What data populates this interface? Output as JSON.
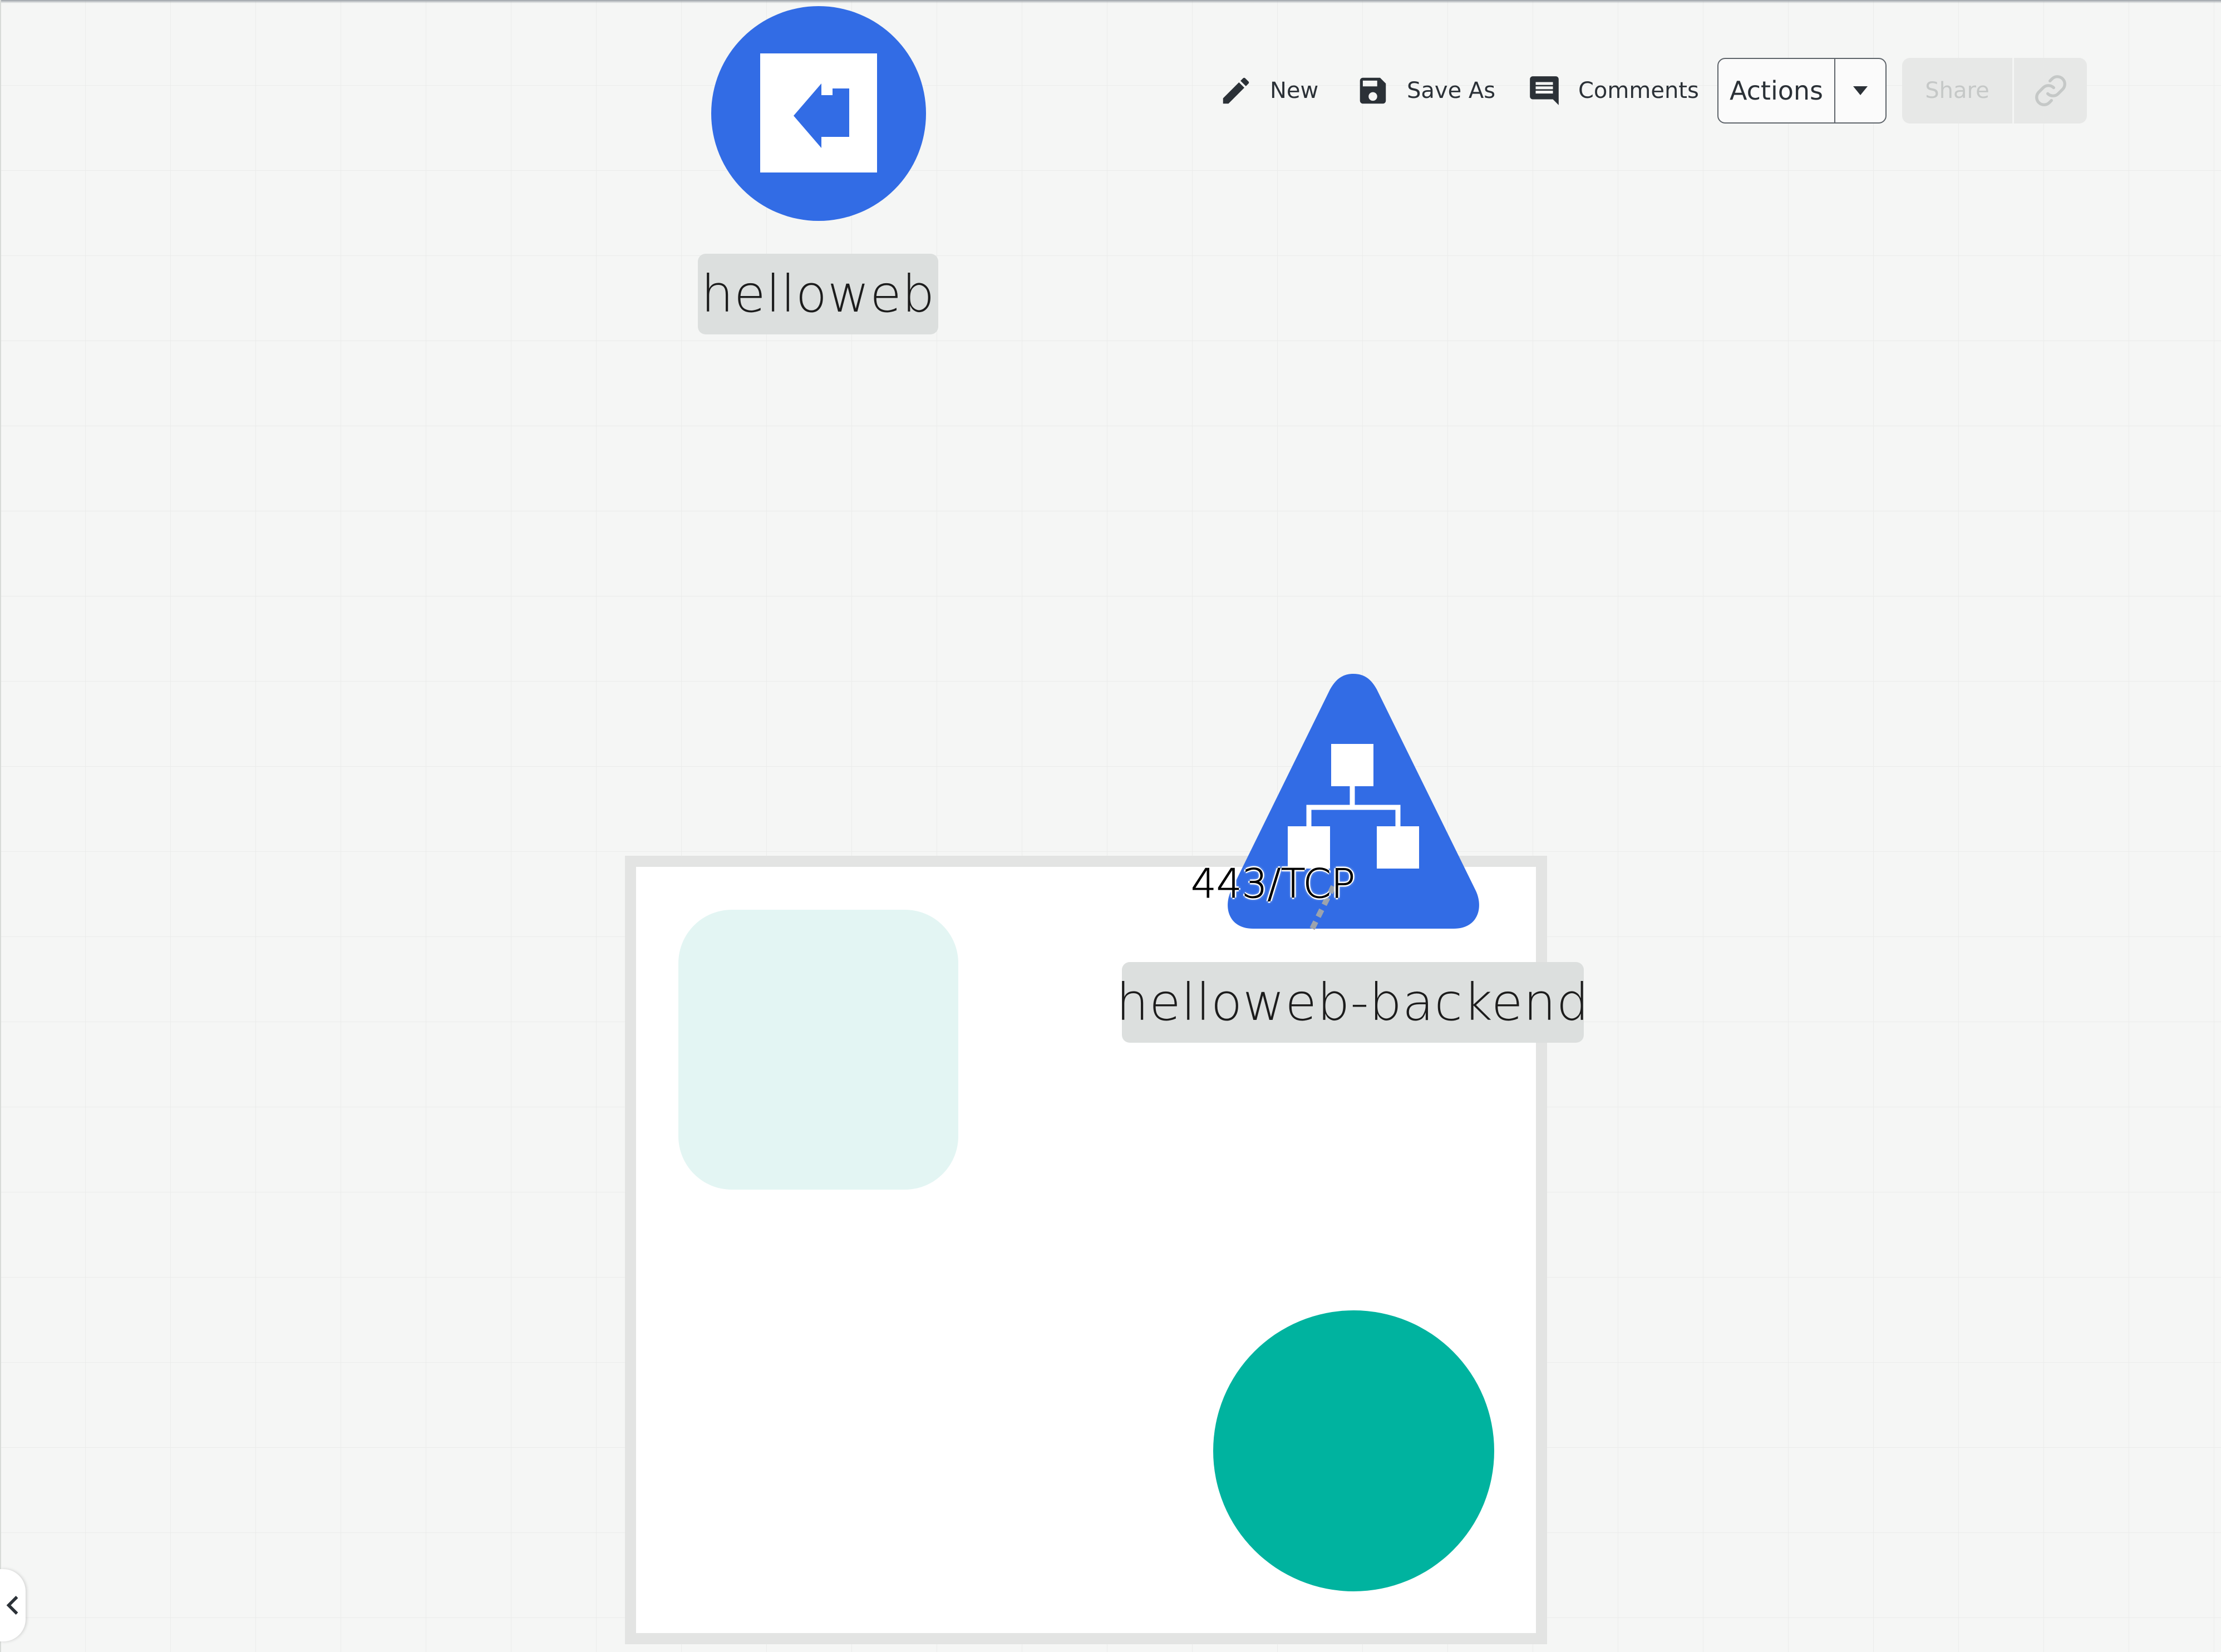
{
  "toolbar": {
    "new_label": "New",
    "save_as_label": "Save As",
    "comments_label": "Comments",
    "actions_label": "Actions",
    "share_label": "Share",
    "icons": [
      "pencil-icon",
      "floppy-disk-icon",
      "comment-icon",
      "caret-down-icon",
      "link-icon"
    ]
  },
  "canvas": {
    "nodes": [
      {
        "label": "helloweb",
        "kind": "ingress",
        "icon": "ingress-icon",
        "color": "#326ce5"
      },
      {
        "label": "helloweb-backend",
        "kind": "service",
        "icon": "service-icon",
        "color": "#326ce5"
      }
    ],
    "edge_label": "443/TCP",
    "colors": {
      "kubernetes_blue": "#326ce5",
      "pod_teal": "#00b39f",
      "deployment_fill": "#e3f5f3",
      "label_background": "#dcdfde"
    }
  }
}
